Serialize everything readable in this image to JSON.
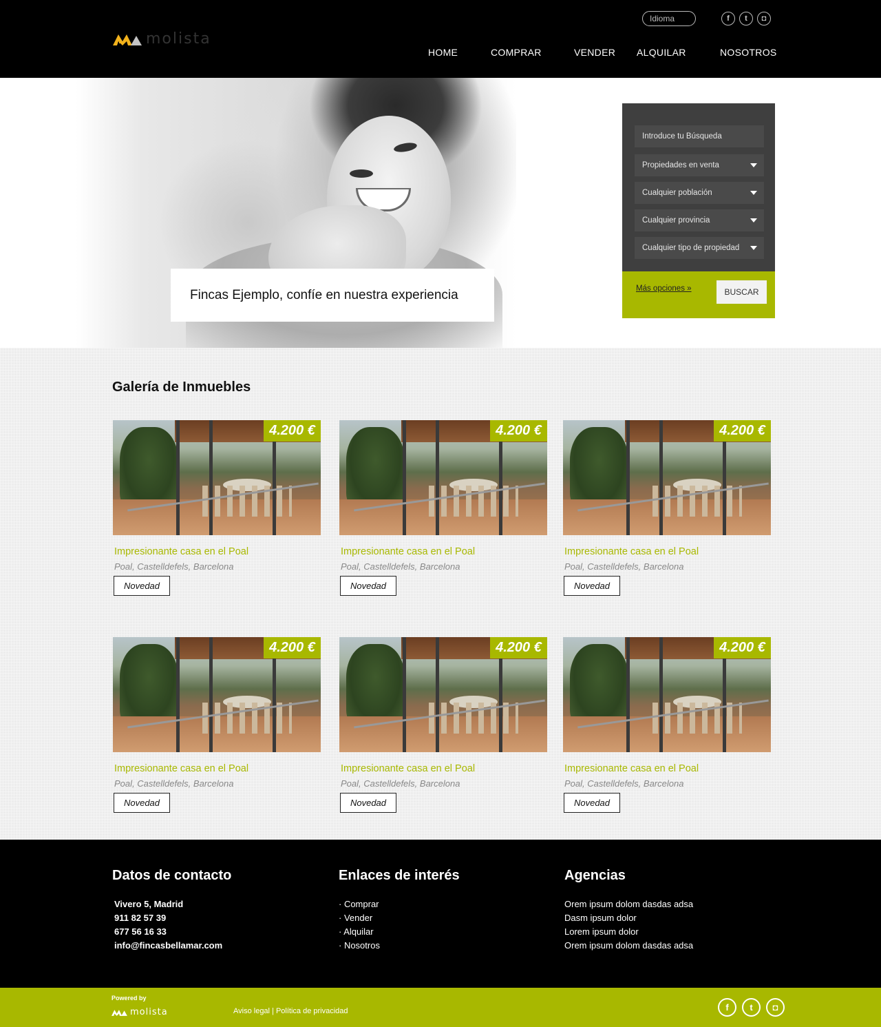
{
  "header": {
    "logo_text": "molista",
    "language_label": "Idioma",
    "social": [
      "facebook-icon",
      "twitter-icon",
      "instagram-icon"
    ],
    "nav": [
      "HOME",
      "COMPRAR",
      "VENDER",
      "ALQUILAR",
      "NOSOTROS"
    ]
  },
  "hero": {
    "tagline": "Fincas Ejemplo, confíe en nuestra experiencia"
  },
  "search": {
    "query_placeholder": "Introduce tu Búsqueda",
    "fields": [
      "Propiedades en venta",
      "Cualquier población",
      "Cualquier provincia",
      "Cualquier tipo de propiedad"
    ],
    "more_options": "Más opciones »",
    "submit": "BUSCAR"
  },
  "gallery": {
    "title": "Galería de Inmuebles",
    "cards": [
      {
        "price": "4.200 €",
        "title": "Impresionante casa en el Poal",
        "location": "Poal, Castelldefels, Barcelona",
        "badge": "Novedad"
      },
      {
        "price": "4.200 €",
        "title": "Impresionante casa en el Poal",
        "location": "Poal, Castelldefels, Barcelona",
        "badge": "Novedad"
      },
      {
        "price": "4.200 €",
        "title": "Impresionante casa en el Poal",
        "location": "Poal, Castelldefels, Barcelona",
        "badge": "Novedad"
      },
      {
        "price": "4.200 €",
        "title": "Impresionante casa en el Poal",
        "location": "Poal, Castelldefels, Barcelona",
        "badge": "Novedad"
      },
      {
        "price": "4.200 €",
        "title": "Impresionante casa en el Poal",
        "location": "Poal, Castelldefels, Barcelona",
        "badge": "Novedad"
      },
      {
        "price": "4.200 €",
        "title": "Impresionante casa en el Poal",
        "location": "Poal, Castelldefels, Barcelona",
        "badge": "Novedad"
      }
    ]
  },
  "footer": {
    "contact": {
      "title": "Datos de contacto",
      "lines": [
        "Vivero 5, Madrid",
        "911 82 57 39",
        "677 56 16 33",
        "info@fincasbellamar.com"
      ]
    },
    "links": {
      "title": "Enlaces de interés",
      "items": [
        "· Comprar",
        "· Vender",
        "· Alquilar",
        "· Nosotros"
      ]
    },
    "agencies": {
      "title": "Agencias",
      "items": [
        "Orem ipsum dolom dasdas adsa",
        "Dasm ipsum dolor",
        "Lorem ipsum dolor",
        "Orem ipsum dolom dasdas adsa"
      ]
    }
  },
  "bottom_bar": {
    "powered_by": "Powered by",
    "logo_text": "molista",
    "legal": "Aviso legal | Política de privacidad"
  },
  "colors": {
    "accent": "#a8b800",
    "header_bg": "#000000",
    "search_bg": "#3f3f3f"
  }
}
